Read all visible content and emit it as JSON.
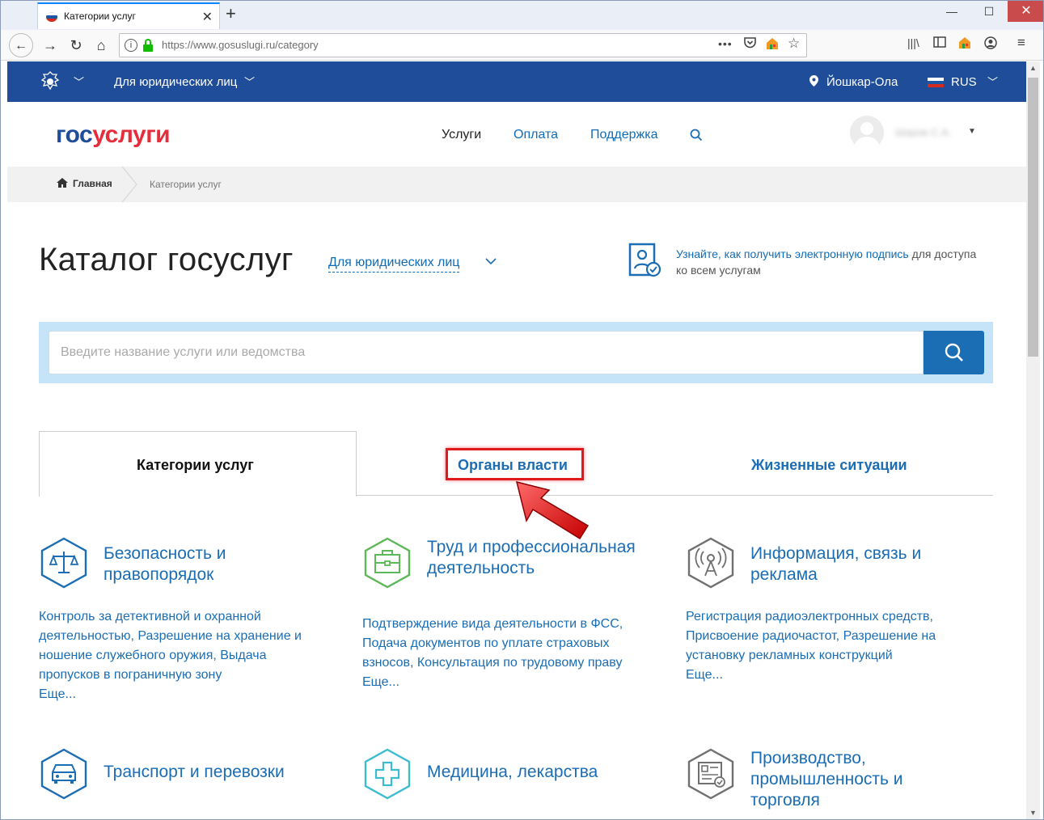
{
  "browser": {
    "tab_title": "Категории услуг",
    "url": "https://www.gosuslugi.ru/category",
    "icons": [
      "back-icon",
      "forward-icon",
      "reload-icon",
      "home-icon",
      "info-icon",
      "lock-icon",
      "more-icon",
      "pocket-icon",
      "bookmark-star-icon",
      "library-icon",
      "sidebar-icon",
      "menu-icon"
    ]
  },
  "topbar": {
    "audience": "Для юридических лиц",
    "city": "Йошкар-Ола",
    "lang": "RUS"
  },
  "header": {
    "logo_part1": "гос",
    "logo_part2": "услуги",
    "menu": [
      "Услуги",
      "Оплата",
      "Поддержка"
    ],
    "user_name": "Шаров С.А."
  },
  "breadcrumbs": {
    "home": "Главная",
    "current": "Категории услуг"
  },
  "catalog": {
    "title": "Каталог госуслуг",
    "audience_select": "Для юридических лиц",
    "sign_link": "Узнайте, как получить электронную подпись",
    "sign_rest_1": " для доступа",
    "sign_rest_2": "ко всем услугам"
  },
  "search": {
    "placeholder": "Введите название услуги или ведомства",
    "value": ""
  },
  "tabs": [
    "Категории услуг",
    "Органы власти",
    "Жизненные ситуации"
  ],
  "categories": [
    {
      "title": "Безопасность и правопорядок",
      "desc": "Контроль за детективной и охранной деятельностью, Разрешение на хранение и ношение служебного оружия, Выдача пропусков в пограничную зону",
      "more": "Еще...",
      "icon": "scales-icon"
    },
    {
      "title": "Труд и профессиональная деятельность",
      "desc": "Подтверждение вида деятельности в ФСС, Подача документов по уплате страховых взносов, Консультация по трудовому праву",
      "more": "Еще...",
      "icon": "briefcase-icon"
    },
    {
      "title": "Информация, связь и реклама",
      "desc": "Регистрация радиоэлектронных средств, Присвоение радиочастот, Разрешение на установку рекламных конструкций",
      "more": "Еще...",
      "icon": "antenna-icon"
    },
    {
      "title": "Транспорт и перевозки",
      "icon": "car-icon"
    },
    {
      "title": "Медицина, лекарства",
      "icon": "medical-cross-icon"
    },
    {
      "title": "Производство, промышленность и торговля",
      "icon": "certificate-icon"
    }
  ],
  "colors": {
    "topbar": "#1f4d9a",
    "link": "#1b6db4",
    "logo_red": "#e52d3c",
    "highlight": "#e0191d",
    "search_bg": "#c5e4f8"
  }
}
